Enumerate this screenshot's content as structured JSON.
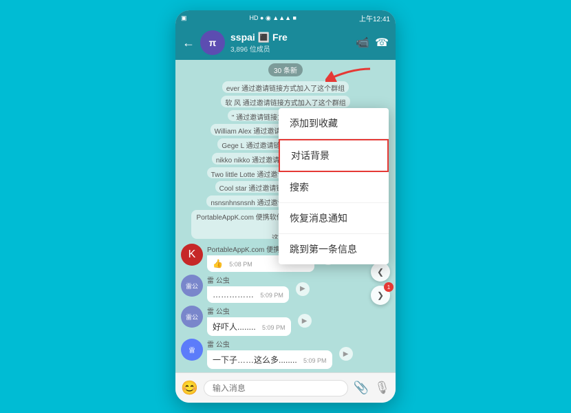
{
  "statusBar": {
    "left": "▣",
    "time": "上午12:41",
    "icons": "HD ● ◉ ▲▲▲ ■"
  },
  "header": {
    "backLabel": "←",
    "avatarLabel": "π",
    "name": "sspai 🔳 Fre",
    "subtitle": "3,896 位成员",
    "icons": [
      "📹",
      "☎"
    ]
  },
  "chat": {
    "newMessagesBadge": "30 条新",
    "systemMessages": [
      "ever 通过邀请链接方式加入了这个群组",
      "软 风 通过邀请链接方式加入了这个群组",
      "\" 通过邀请链接方式加入了这个群组",
      "William Alex 通过邀请链接方式加入了这个群组",
      "Gege L 通过邀请链接方式加入了这个群组",
      "nikko nikko 通过邀请链接方式加入了这个群组",
      "Two little Lotte 通过邀请链接方式加入了这个群组",
      "Cool star 通过邀请链接方式加入了这个群组",
      "nsnsnhnsnsnh 通过邀请链接方式加入了这个群组",
      "PortableAppK.com 便携软件倡导者 通过邀请链接方式加入了这个群组"
    ],
    "messages": [
      {
        "sender": "PortableAppK.com 便携软件倡导者",
        "avatar": "K",
        "avatarClass": "portableappk",
        "content": "👍",
        "time": "5:08 PM"
      },
      {
        "sender": "雷 公虫",
        "avatar": "雷",
        "avatarClass": "lei",
        "content": "……………",
        "time": "5:09 PM"
      },
      {
        "sender": "雷 公虫",
        "avatar": "雷",
        "avatarClass": "lei",
        "content": "好吓人........",
        "time": "5:09 PM"
      },
      {
        "sender": "雷 公虫",
        "avatar": "雷",
        "avatarClass": "lei",
        "content": "一下子……这么多........",
        "time": "5:09 PM"
      }
    ]
  },
  "inputBar": {
    "placeholder": "输入消息",
    "emojiIcon": "😊",
    "attachIcon": "📎",
    "micIcon": "🎙"
  },
  "dropdownMenu": {
    "items": [
      {
        "label": "添加到收藏",
        "active": false
      },
      {
        "label": "对话背景",
        "active": true
      },
      {
        "label": "搜索",
        "active": false
      },
      {
        "label": "恢复消息通知",
        "active": false
      },
      {
        "label": "跳到第一条信息",
        "active": false
      }
    ]
  },
  "scrollButtons": {
    "upIcon": "❮",
    "downIcon": "❯",
    "badge": "1"
  }
}
